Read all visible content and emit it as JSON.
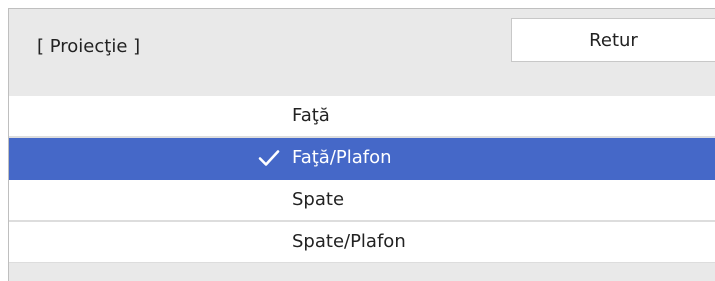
{
  "header": {
    "title": "[ Proiecţie ]",
    "return_label": "Retur"
  },
  "options": [
    {
      "label": "Faţă",
      "selected": false
    },
    {
      "label": "Faţă/Plafon",
      "selected": true
    },
    {
      "label": "Spate",
      "selected": false
    },
    {
      "label": "Spate/Plafon",
      "selected": false
    }
  ],
  "colors": {
    "selection": "#4568c8",
    "panel": "#e9e9e9"
  },
  "icons": {
    "selected_marker": "checkmark-icon"
  }
}
